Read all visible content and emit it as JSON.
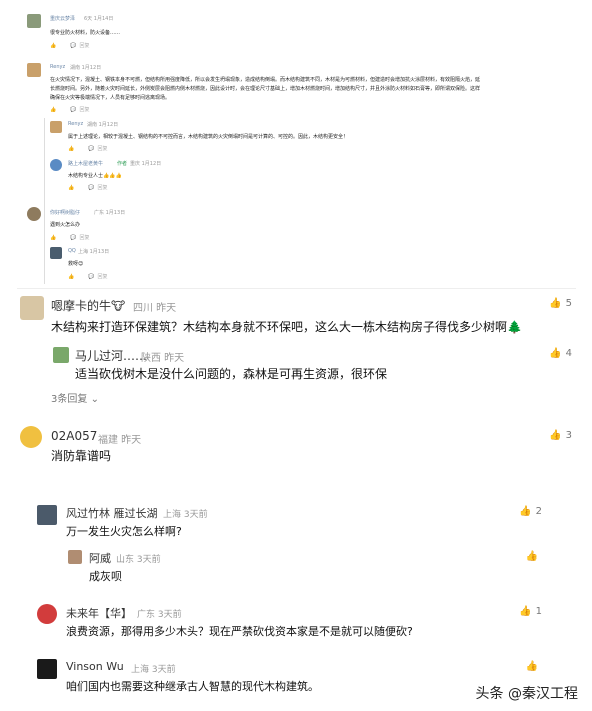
{
  "thread_small": [
    {
      "name": "重庆云梦泽",
      "meta": "6天 1月14日",
      "text": "很专业防火材料，防火设备……",
      "reply": "回复"
    },
    {
      "name": "Renyz",
      "meta": "湖南 1月12日",
      "text_lines": [
        "在火灾情况下，混凝土、钢铁本身不可燃，但结构所用强度降低，所以会发生坍塌现象，造成结构倒塌。而木结构建筑不同，木材是为可燃材料，但建造时会增加抗火涂层材料，有效阻隔火焰，延",
        "长燃烧时间。另外，随着火灾时间延长，外侧炭层会阻燃内侧木材燃烧，因此设计时，会在理论尺寸基础上，增加木材燃烧时间，增加结构尺寸，并且外涂防火材料如石膏等，即所谓双保险。这样",
        "确保在火灾等极端情况下，人员有足够时间逃离现场。"
      ],
      "reply": "回复"
    },
    {
      "name": "Renyz",
      "meta": "湖南 1月12日",
      "text": "属于上述理论，相较于混凝土、钢结构的不可控而言，木结构建筑的火灾倒塌时间是可计算的、可控的。因此，木结构更安全！",
      "reply": "回复"
    },
    {
      "name": "路上木屋老黄牛",
      "badge": "作者",
      "meta": "重庆 1月12日",
      "text": "木结构专业人士👍👍👍",
      "reply": "回复"
    },
    {
      "name": "你好啊树脂仔",
      "meta": "广东 1月13日",
      "text": "遇到火怎么办",
      "reply": "回复"
    },
    {
      "name": "QQ",
      "meta": "上海 1月13日",
      "text": "救呀😊",
      "reply": "回复"
    }
  ],
  "comments": [
    {
      "name": "嗯摩卡的牛",
      "emoji": "🐮",
      "meta": "四川 昨天",
      "text": "木结构来打造环保建筑？木结构本身就不环保吧，这么大一栋木结构房子得伐多少树啊🌲",
      "likes": "5"
    },
    {
      "name": "马儿过河……",
      "meta": "陕西 昨天",
      "text": "适当砍伐树木是没什么问题的，森林是可再生资源，很环保",
      "likes": "4"
    },
    {
      "more": "3条回复"
    },
    {
      "name": "02A057",
      "meta": "福建 昨天",
      "text": "消防靠谱吗",
      "likes": "3"
    },
    {
      "name": "风过竹林 雁过长湖",
      "meta": "上海 3天前",
      "text": "万一发生火灾怎么样啊?",
      "likes": "2"
    },
    {
      "name": "阿威",
      "meta": "山东 3天前",
      "text": "成灰呗",
      "likes": ""
    },
    {
      "name": "未来年【华】",
      "meta": "广东 3天前",
      "text": "浪费资源，那得用多少木头？现在严禁砍伐资本家是不是就可以随便砍?",
      "likes": "1"
    },
    {
      "name": "Vinson Wu",
      "meta": "上海 3天前",
      "text": "咱们国内也需要这种继承古人智慧的现代木构建筑。",
      "likes": ""
    }
  ],
  "watermark": "头条 @秦汉工程"
}
